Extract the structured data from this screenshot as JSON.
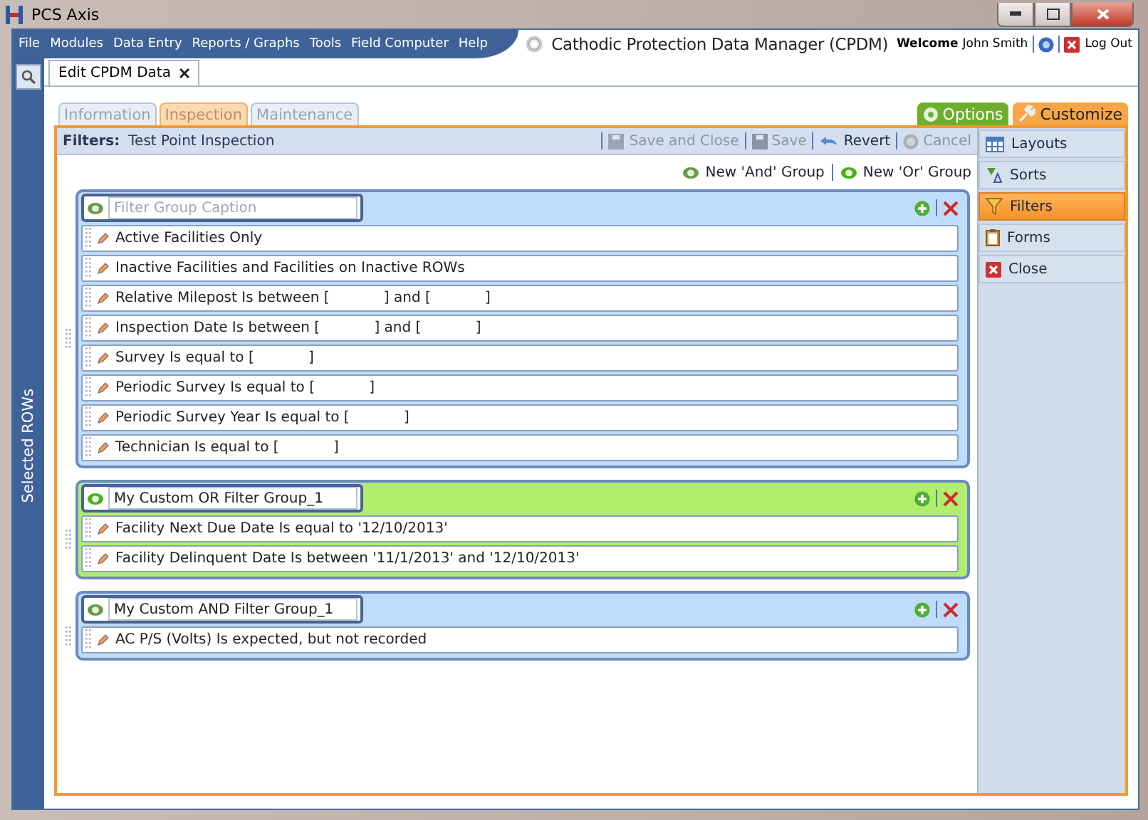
{
  "window": {
    "title": "PCS Axis"
  },
  "menu": [
    "File",
    "Modules",
    "Data Entry",
    "Reports / Graphs",
    "Tools",
    "Field Computer",
    "Help"
  ],
  "app_title": "Cathodic Protection Data Manager (CPDM)",
  "user": {
    "greeting": "Welcome",
    "name": "John Smith",
    "logout": "Log Out"
  },
  "doc_tabs": [
    {
      "label": "Edit CPDM Data",
      "selected": true
    }
  ],
  "side_strip": {
    "label": "Selected ROWs"
  },
  "view_tabs": [
    {
      "label": "Information",
      "selected": false
    },
    {
      "label": "Inspection",
      "selected": true
    },
    {
      "label": "Maintenance",
      "selected": false
    }
  ],
  "panel_tabs": [
    {
      "label": "Options",
      "kind": "options"
    },
    {
      "label": "Customize",
      "kind": "customize"
    }
  ],
  "filters": {
    "label": "Filters:",
    "name": "Test Point Inspection"
  },
  "toolbar": [
    {
      "label": "Save and Close",
      "kind": "save-close",
      "disabled": true
    },
    {
      "label": "Save",
      "kind": "save",
      "disabled": true
    },
    {
      "label": "Revert",
      "kind": "revert",
      "disabled": false
    },
    {
      "label": "Cancel",
      "kind": "cancel",
      "disabled": true
    }
  ],
  "group_actions": [
    {
      "label": "New 'And' Group",
      "kind": "and"
    },
    {
      "label": "New 'Or' Group",
      "kind": "or"
    }
  ],
  "groups": [
    {
      "kind": "and",
      "placeholder": "Filter Group Caption",
      "conditions": [
        "Active Facilities Only",
        "Inactive Facilities and Facilities on Inactive ROWs",
        "Relative Milepost Is between [            ] and [            ]",
        "Inspection Date Is between [            ] and [            ]",
        "Survey Is equal to [            ]",
        "Periodic Survey Is equal to [            ]",
        "Periodic Survey Year Is equal to [            ]",
        "Technician Is equal to [            ]"
      ]
    },
    {
      "kind": "or",
      "caption": "My Custom OR Filter Group_1",
      "conditions": [
        "Facility Next Due Date Is equal to '12/10/2013'",
        "Facility Delinquent Date Is between '11/1/2013' and '12/10/2013'"
      ]
    },
    {
      "kind": "and",
      "caption": "My Custom AND Filter Group_1",
      "conditions": [
        "AC P/S (Volts) Is expected, but not recorded"
      ]
    }
  ],
  "sidebar": [
    {
      "label": "Layouts",
      "kind": "layouts",
      "selected": false
    },
    {
      "label": "Sorts",
      "kind": "sorts",
      "selected": false
    },
    {
      "label": "Filters",
      "kind": "filters",
      "selected": true
    },
    {
      "label": "Forms",
      "kind": "forms",
      "selected": false
    },
    {
      "label": "Close",
      "kind": "close",
      "selected": false
    }
  ]
}
